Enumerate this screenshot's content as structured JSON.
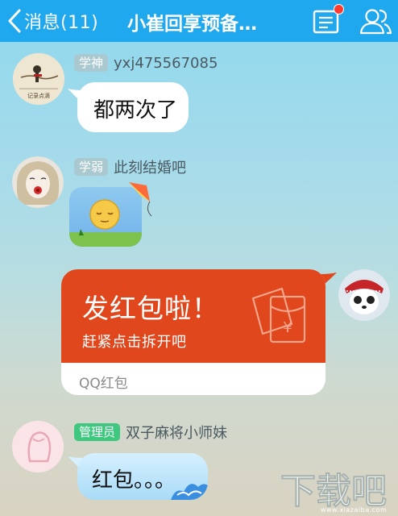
{
  "header": {
    "back_label": "消息(11)",
    "title": "小崔回享预备…",
    "notification_dot_color": "#ff3b30",
    "bar_color": "#20a8ef"
  },
  "messages": [
    {
      "badge": "学神",
      "nickname": "yxj475567085",
      "text": "都两次了",
      "avatar_caption": "记录点滴"
    },
    {
      "badge": "学弱",
      "nickname": "此刻结婚吧",
      "content": "sleepy-face-emoji-sticker"
    },
    {
      "self": true,
      "redpack": {
        "title": "发红包啦！",
        "subtitle": "赶紧点击拆开吧",
        "footer": "QQ红包",
        "symbol": "¥",
        "color": "#e0471c"
      }
    },
    {
      "badge": "管理员",
      "nickname": "双子麻将小师妹",
      "text": "红包。。。"
    }
  ],
  "watermark": {
    "main": "下载吧",
    "sub": "www.xiazaiba.com"
  }
}
